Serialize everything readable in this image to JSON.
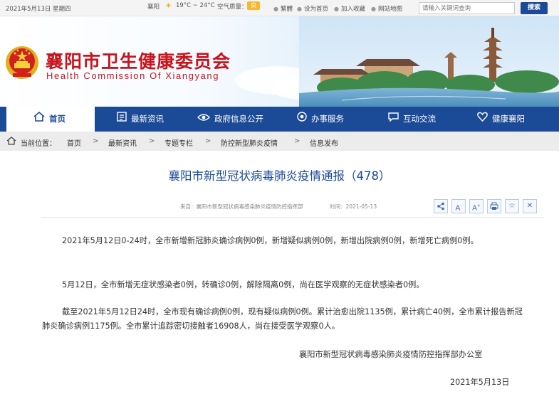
{
  "topbar": {
    "date": "2021年5月13日 星期四",
    "city": "襄阳",
    "weather_icon": "sun-icon",
    "temperature": "19°C ~ 24°C",
    "air_quality_label": "空气质量：",
    "air_quality_value": "良",
    "links": [
      "繁體",
      "设为首页",
      "加入收藏",
      "网站地图"
    ],
    "search_placeholder": "请输入关键词查询",
    "search_button": "搜索"
  },
  "banner": {
    "title_zh": "襄阳市卫生健康委员会",
    "title_en": "Health Commission Of Xiangyang",
    "emblem": "national-emblem"
  },
  "nav": {
    "items": [
      {
        "label": "首页",
        "icon": "home-icon"
      },
      {
        "label": "最新资讯",
        "icon": "news-icon"
      },
      {
        "label": "政府信息公开",
        "icon": "eye-icon"
      },
      {
        "label": "办事服务",
        "icon": "service-icon"
      },
      {
        "label": "互动交流",
        "icon": "chat-icon"
      },
      {
        "label": "健康襄阳",
        "icon": "heart-icon"
      }
    ],
    "active_index": 0
  },
  "breadcrumb": {
    "prefix": "当前位置：",
    "items": [
      "首页",
      "最新资讯",
      "专题专栏",
      "防控新型肺炎疫情",
      "信息发布"
    ],
    "separator": ">"
  },
  "article": {
    "title": "襄阳市新型冠状病毒肺炎疫情通报（478）",
    "source": "来自：襄阳市新型冠状病毒感染肺炎疫情防控指挥部",
    "time": "时间：2021-05-13",
    "tools": [
      "share-icon",
      "font-decrease-icon",
      "font-increase-icon",
      "print-icon",
      "favorite-icon",
      "close-icon"
    ],
    "tool_labels": [
      "A",
      "A",
      "A"
    ],
    "paragraphs": [
      "2021年5月12日0-24时，全市新增新冠肺炎确诊病例0例，新增疑似病例0例，新增出院病例0例，新增死亡病例0例。",
      "5月12日，全市新增无症状感染者0例，转确诊0例，解除隔离0例，尚在医学观察的无症状感染者0例。",
      "截至2021年5月12日24时，全市现有确诊病例0例，现有疑似病例0例。累计治愈出院1135例，累计病亡40例，全市累计报告新冠肺炎确诊病例1175例。全市累计追踪密切接触者16908人，尚在接受医学观察0人。"
    ],
    "signature": "襄阳市新型冠状病毒感染肺炎疫情防控指挥部办公室",
    "sign_date": "2021年5月13日"
  },
  "colors": {
    "brand_blue": "#1b4a97",
    "brand_red": "#c8141d",
    "crumb_bg": "#ececec"
  }
}
